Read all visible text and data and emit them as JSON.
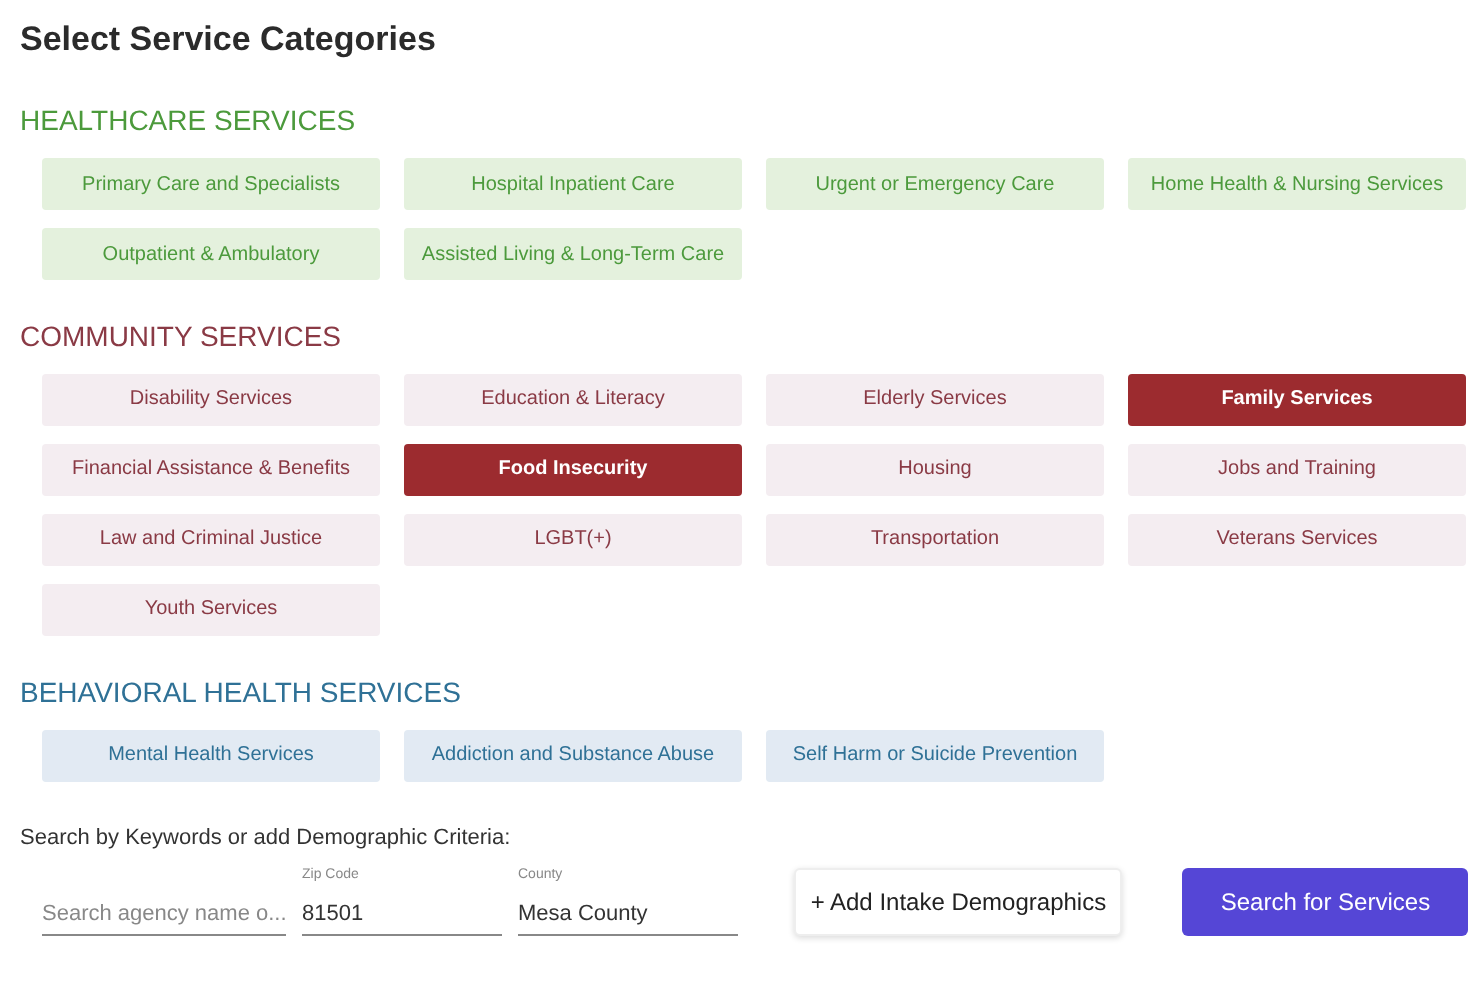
{
  "title": "Select Service Categories",
  "sections": [
    {
      "kind": "healthcare",
      "heading": "HEALTHCARE SERVICES",
      "items": [
        {
          "label": "Primary Care and Specialists",
          "selected": false
        },
        {
          "label": "Hospital Inpatient Care",
          "selected": false
        },
        {
          "label": "Urgent or Emergency Care",
          "selected": false
        },
        {
          "label": "Home Health & Nursing Services",
          "selected": false
        },
        {
          "label": "Outpatient & Ambulatory",
          "selected": false
        },
        {
          "label": "Assisted Living & Long-Term Care",
          "selected": false
        }
      ]
    },
    {
      "kind": "community",
      "heading": "COMMUNITY SERVICES",
      "items": [
        {
          "label": "Disability Services",
          "selected": false
        },
        {
          "label": "Education & Literacy",
          "selected": false
        },
        {
          "label": "Elderly Services",
          "selected": false
        },
        {
          "label": "Family Services",
          "selected": true
        },
        {
          "label": "Financial Assistance & Benefits",
          "selected": false
        },
        {
          "label": "Food Insecurity",
          "selected": true
        },
        {
          "label": "Housing",
          "selected": false
        },
        {
          "label": "Jobs and Training",
          "selected": false
        },
        {
          "label": "Law and Criminal Justice",
          "selected": false
        },
        {
          "label": "LGBT(+)",
          "selected": false
        },
        {
          "label": "Transportation",
          "selected": false
        },
        {
          "label": "Veterans Services",
          "selected": false
        },
        {
          "label": "Youth Services",
          "selected": false
        }
      ]
    },
    {
      "kind": "behavioral",
      "heading": "BEHAVIORAL HEALTH SERVICES",
      "items": [
        {
          "label": "Mental Health Services",
          "selected": false
        },
        {
          "label": "Addiction and Substance Abuse",
          "selected": false
        },
        {
          "label": "Self Harm or Suicide Prevention",
          "selected": false
        }
      ]
    }
  ],
  "search": {
    "label": "Search by Keywords or add Demographic Criteria:",
    "keyword": {
      "placeholder": "Search agency name o..."
    },
    "zip": {
      "label": "Zip Code",
      "value": "81501"
    },
    "county": {
      "label": "County",
      "value": "Mesa County"
    },
    "buttons": [
      {
        "kind": "outline",
        "label": "+ Add Intake Demographics"
      },
      {
        "kind": "primary",
        "label": "Search for Services"
      }
    ]
  }
}
